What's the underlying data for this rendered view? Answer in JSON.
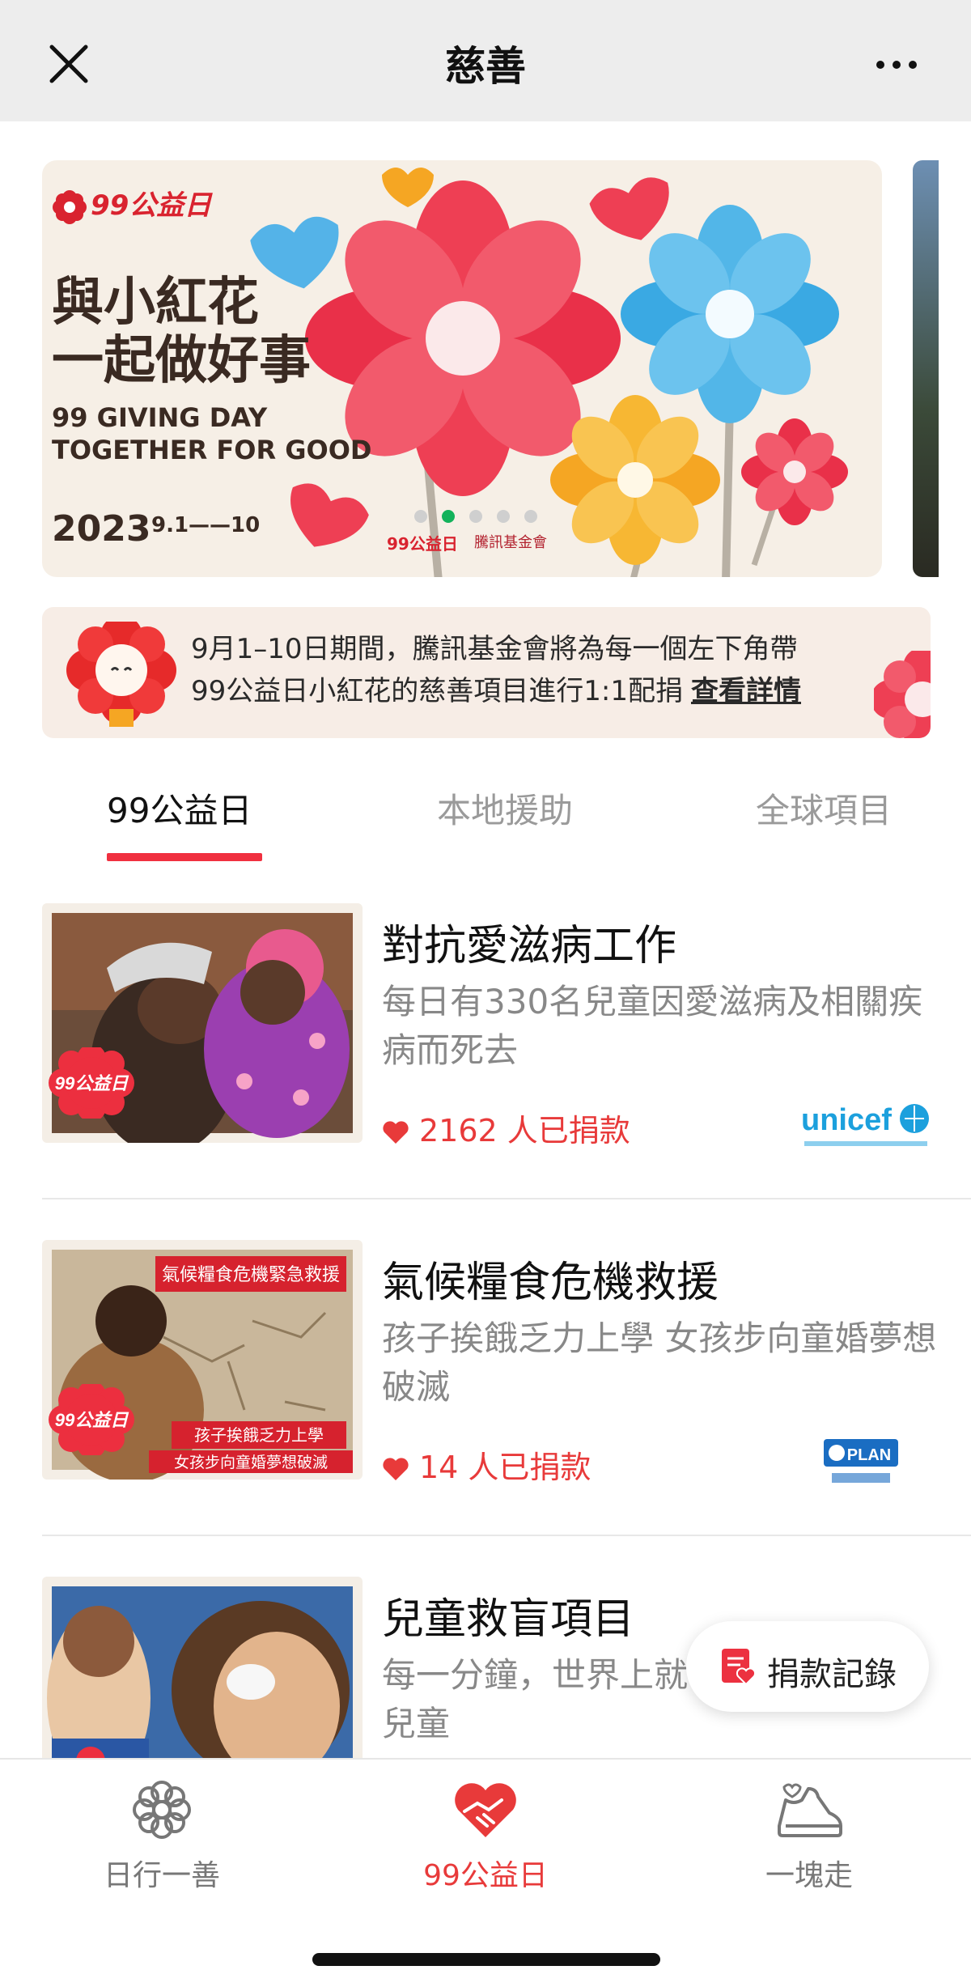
{
  "navbar": {
    "title": "慈善",
    "close_icon": "close-icon",
    "more_icon": "more-dots-icon"
  },
  "banner": {
    "logo_text": "99公益日",
    "headline_line1": "與小紅花",
    "headline_line2": "一起做好事",
    "english_line1": "99 GIVING DAY",
    "english_line2": "TOGETHER FOR GOOD",
    "year": "2023",
    "dates": "9.1——10",
    "sponsor_1": "99公益日",
    "sponsor_2": "騰訊基金會",
    "carousel_total": 5,
    "carousel_active_index": 1
  },
  "notice": {
    "line1": "9月1–10日期間，騰訊基金會將為每一個左下角帶",
    "line2": "99公益日小紅花的慈善項目進行1:1配捐",
    "link": "查看詳情"
  },
  "tabs": [
    {
      "label": "99公益日",
      "active": true
    },
    {
      "label": "本地援助",
      "active": false
    },
    {
      "label": "全球項目",
      "active": false
    }
  ],
  "items": [
    {
      "title": "對抗愛滋病工作",
      "desc": "每日有330名兒童因愛滋病及相關疾病而死去",
      "count": "2162 人已捐款",
      "badge": "99公益日",
      "org": "unicef"
    },
    {
      "title": "氣候糧食危機救援",
      "desc": "孩子挨餓乏力上學 女孩步向童婚夢想破滅",
      "count": "14 人已捐款",
      "badge": "99公益日",
      "thumb_caption_top": "氣候糧食危機緊急救援",
      "thumb_caption_b1": "孩子挨餓乏力上學",
      "thumb_caption_b2": "女孩步向童婚夢想破滅",
      "org": "PLAN"
    },
    {
      "title": "兒童救盲項目",
      "desc_part1": "每一分鐘，世界上就",
      "desc_part2": "兒童"
    }
  ],
  "float_button": {
    "label": "捐款記錄",
    "icon": "donation-record-icon"
  },
  "tabbar": [
    {
      "label": "日行一善",
      "icon": "flower-outline-icon",
      "active": false
    },
    {
      "label": "99公益日",
      "icon": "heart-handshake-icon",
      "active": true
    },
    {
      "label": "一塊走",
      "icon": "sneaker-icon",
      "active": false
    }
  ],
  "colors": {
    "accent_red": "#e83a3a",
    "tab_underline": "#f03040",
    "navbar_bg": "#ededed",
    "carousel_active": "#13b25b"
  }
}
